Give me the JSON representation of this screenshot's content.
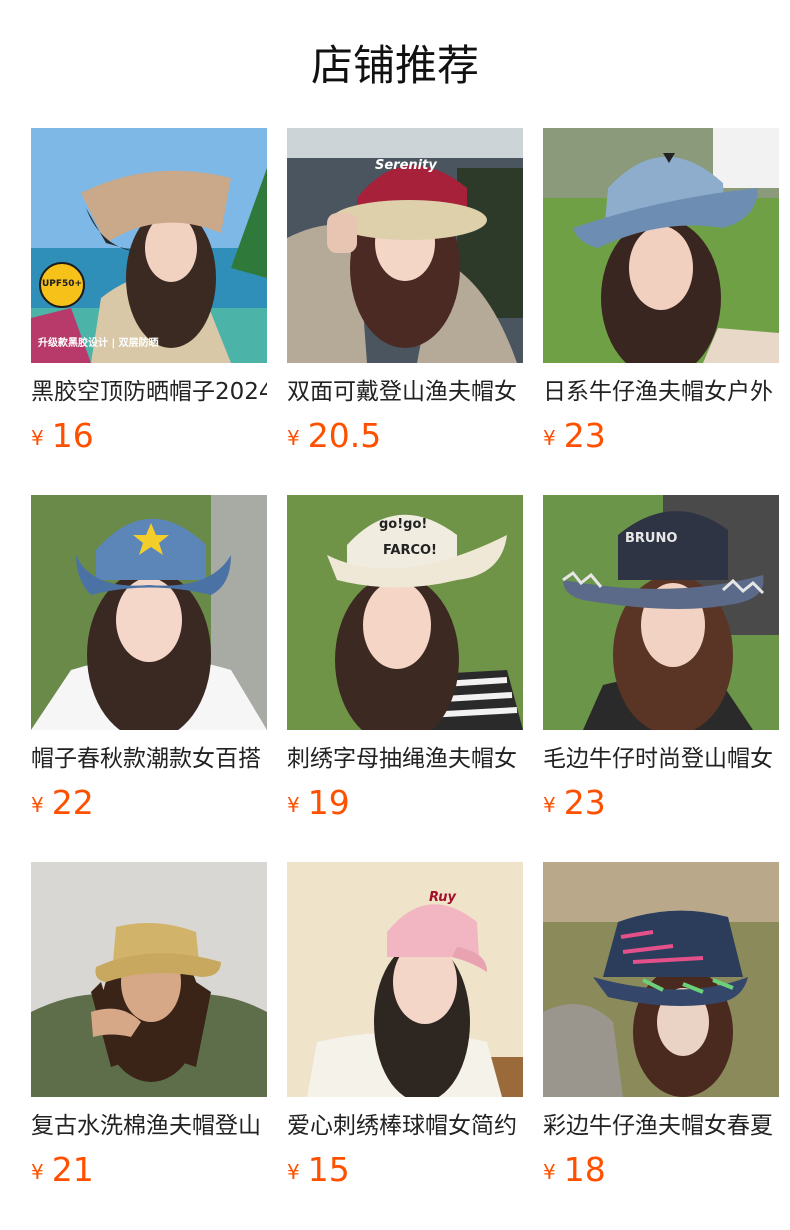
{
  "section_title": "店铺推荐",
  "currency_symbol": "¥",
  "products": [
    {
      "name": "黑胶空顶防晒帽子2024",
      "price": "16",
      "image": "beige-visor-sun-hat-photo",
      "promo_text": "升级款黑胶设计 | 双层防晒",
      "badge_text": "UPF50+"
    },
    {
      "name": "双面可戴登山渔夫帽女",
      "price": "20.5",
      "image": "reversible-bucket-hat-photo",
      "hat_text": "Serenity"
    },
    {
      "name": "日系牛仔渔夫帽女户外",
      "price": "23",
      "image": "denim-cowboy-hat-photo"
    },
    {
      "name": "帽子春秋款潮款女百搭",
      "price": "22",
      "image": "star-denim-cowboy-hat-photo"
    },
    {
      "name": "刺绣字母抽绳渔夫帽女",
      "price": "19",
      "image": "letter-embroidered-bucket-hat-photo",
      "hat_text_1": "go!go!",
      "hat_text_2": "FARCO!"
    },
    {
      "name": "毛边牛仔时尚登山帽女",
      "price": "23",
      "image": "frayed-denim-cowboy-hat-photo",
      "hat_text": "BRUNO"
    },
    {
      "name": "复古水洗棉渔夫帽登山",
      "price": "21",
      "image": "washed-cotton-bucket-hat-photo"
    },
    {
      "name": "爱心刺绣棒球帽女简约",
      "price": "15",
      "image": "pink-baseball-cap-photo",
      "hat_text": "Ruy"
    },
    {
      "name": "彩边牛仔渔夫帽女春夏",
      "price": "18",
      "image": "colorful-denim-bucket-hat-photo"
    }
  ]
}
